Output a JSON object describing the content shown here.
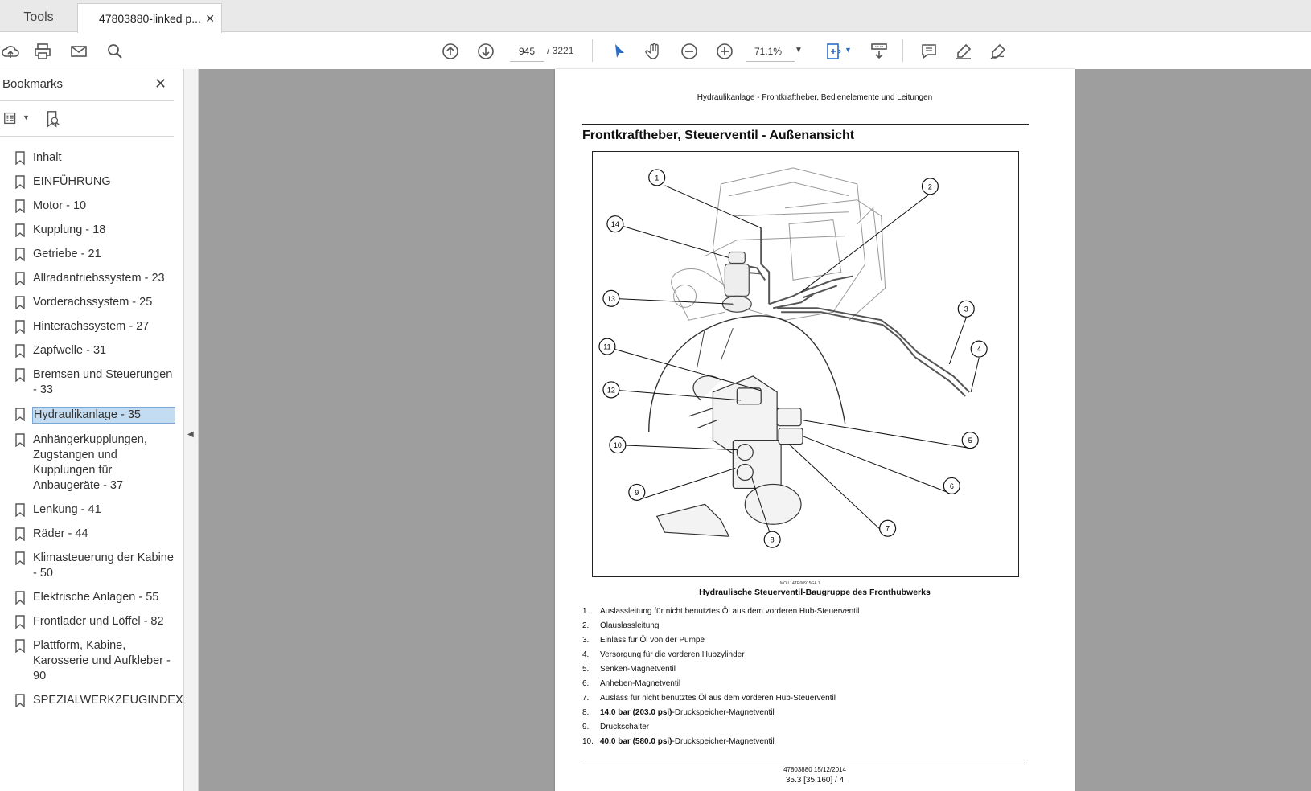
{
  "tabs": {
    "tools_label": "Tools",
    "doc_label": "47803880-linked p...",
    "close_symbol": "✕"
  },
  "toolbar": {
    "page_current": "945",
    "page_total": "/ 3221",
    "zoom": "71.1%",
    "icons": [
      "upload-icon",
      "print-icon",
      "mail-icon",
      "zoom-search-icon",
      "page-up-icon",
      "page-down-icon",
      "select-cursor-icon",
      "hand-icon",
      "zoom-out-icon",
      "zoom-in-icon",
      "fit-page-icon",
      "scroll-mode-icon",
      "comment-icon",
      "highlight-pen-icon",
      "sign-icon"
    ]
  },
  "sidebar": {
    "title": "Bookmarks",
    "close_symbol": "✕",
    "items": [
      {
        "label": "Inhalt",
        "selected": false
      },
      {
        "label": "EINFÜHRUNG",
        "selected": false
      },
      {
        "label": "Motor - 10",
        "selected": false
      },
      {
        "label": "Kupplung - 18",
        "selected": false
      },
      {
        "label": "Getriebe - 21",
        "selected": false
      },
      {
        "label": "Allradantriebssystem - 23",
        "selected": false
      },
      {
        "label": "Vorderachssystem - 25",
        "selected": false
      },
      {
        "label": "Hinterachssystem - 27",
        "selected": false
      },
      {
        "label": "Zapfwelle - 31",
        "selected": false
      },
      {
        "label": "Bremsen und Steuerungen - 33",
        "selected": false
      },
      {
        "label": "Hydraulikanlage - 35",
        "selected": true
      },
      {
        "label": "Anhängerkupplungen, Zugstangen und Kupplungen für Anbaugeräte - 37",
        "selected": false
      },
      {
        "label": "Lenkung - 41",
        "selected": false
      },
      {
        "label": "Räder - 44",
        "selected": false
      },
      {
        "label": "Klimasteuerung der Kabine - 50",
        "selected": false
      },
      {
        "label": "Elektrische Anlagen - 55",
        "selected": false
      },
      {
        "label": "Frontlader und Löffel - 82",
        "selected": false
      },
      {
        "label": "Plattform, Kabine, Karosserie und Aufkleber - 90",
        "selected": false
      },
      {
        "label": "SPEZIALWERKZEUGINDEX",
        "selected": false
      }
    ]
  },
  "page": {
    "header": "Hydraulikanlage - Frontkraftheber, Bedienelemente und Leitungen",
    "heading": "Frontkraftheber, Steuerventil - Außenansicht",
    "figure_ref": "MOIL14TR00915GA   1",
    "caption": "Hydraulische Steuerventil-Baugruppe des Fronthubwerks",
    "callouts": [
      "1",
      "2",
      "3",
      "4",
      "5",
      "6",
      "7",
      "8",
      "9",
      "10",
      "11",
      "12",
      "13",
      "14"
    ],
    "parts": [
      {
        "num": "1.",
        "text": "Auslassleitung für nicht benutztes Öl aus dem vorderen Hub-Steuerventil"
      },
      {
        "num": "2.",
        "text": "Ölauslassleitung"
      },
      {
        "num": "3.",
        "text": "Einlass für Öl von der Pumpe"
      },
      {
        "num": "4.",
        "text": "Versorgung für die vorderen Hubzylinder"
      },
      {
        "num": "5.",
        "text": "Senken-Magnetventil"
      },
      {
        "num": "6.",
        "text": "Anheben-Magnetventil"
      },
      {
        "num": "7.",
        "text": "Auslass für nicht benutztes Öl aus dem vorderen Hub-Steuerventil"
      },
      {
        "num": "8.",
        "bold": "14.0 bar (203.0 psi)",
        "text": "-Druckspeicher-Magnetventil"
      },
      {
        "num": "9.",
        "text": "Druckschalter"
      },
      {
        "num": "10.",
        "bold": "40.0 bar (580.0 psi)",
        "text": "-Druckspeicher-Magnetventil"
      }
    ],
    "footer_line1": "47803880 15/12/2014",
    "footer_line2": "35.3 [35.160] / 4"
  }
}
